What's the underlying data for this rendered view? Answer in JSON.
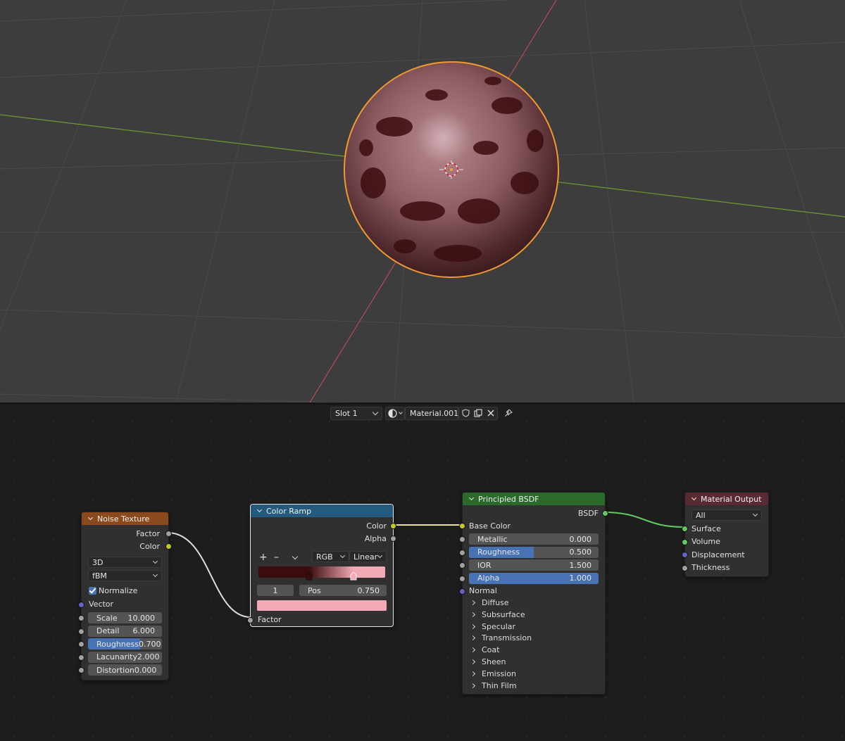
{
  "header": {
    "slot_label": "Slot 1",
    "material_name": "Material.001",
    "icons": [
      "sphere-shading-icon",
      "fake-user-shield-icon",
      "duplicate-icon",
      "close-icon",
      "pin-icon"
    ]
  },
  "nodes": {
    "noise": {
      "title": "Noise Texture",
      "header_color": "#8b4a1e",
      "out_factor": "Factor",
      "out_color": "Color",
      "dimensions": "3D",
      "type": "fBM",
      "normalize_label": "Normalize",
      "normalize_checked": true,
      "vector_label": "Vector",
      "fields": [
        {
          "label": "Scale",
          "value": "10.000",
          "fill": 0
        },
        {
          "label": "Detail",
          "value": "6.000",
          "fill": 0
        },
        {
          "label": "Roughness",
          "value": "0.700",
          "fill": 0.7
        },
        {
          "label": "Lacunarity",
          "value": "2.000",
          "fill": 0
        },
        {
          "label": "Distortion",
          "value": "0.000",
          "fill": 0
        }
      ]
    },
    "ramp": {
      "title": "Color Ramp",
      "header_color": "#245a7d",
      "out_color": "Color",
      "out_alpha": "Alpha",
      "color_mode": "RGB",
      "interpolation": "Linear",
      "stop_index": "1",
      "pos_label": "Pos",
      "pos_value": "0.750",
      "stop_colors": [
        "#3a0c0c",
        "#f4a9b6"
      ],
      "stop_positions": [
        0.4,
        0.75
      ],
      "in_factor": "Factor"
    },
    "bsdf": {
      "title": "Principled BSDF",
      "header_color": "#2c6a2c",
      "out_bsdf": "BSDF",
      "base_color": "Base Color",
      "fields": [
        {
          "label": "Metallic",
          "value": "0.000",
          "fill": 0
        },
        {
          "label": "Roughness",
          "value": "0.500",
          "fill": 0.5
        },
        {
          "label": "IOR",
          "value": "1.500",
          "fill": 0
        },
        {
          "label": "Alpha",
          "value": "1.000",
          "fill": 1
        }
      ],
      "normal": "Normal",
      "panels": [
        "Diffuse",
        "Subsurface",
        "Specular",
        "Transmission",
        "Coat",
        "Sheen",
        "Emission",
        "Thin Film"
      ]
    },
    "output": {
      "title": "Material Output",
      "header_color": "#5a2a33",
      "target": "All",
      "inputs": [
        "Surface",
        "Volume",
        "Displacement",
        "Thickness"
      ]
    }
  },
  "colors": {
    "viewport_bg": "#3d3d3d",
    "grid_line": "#4a4a4a",
    "axis_x": "#b54b55",
    "axis_y": "#6f9a2d",
    "selection_outline": "#f29a2e",
    "accent": "#4772b3"
  }
}
